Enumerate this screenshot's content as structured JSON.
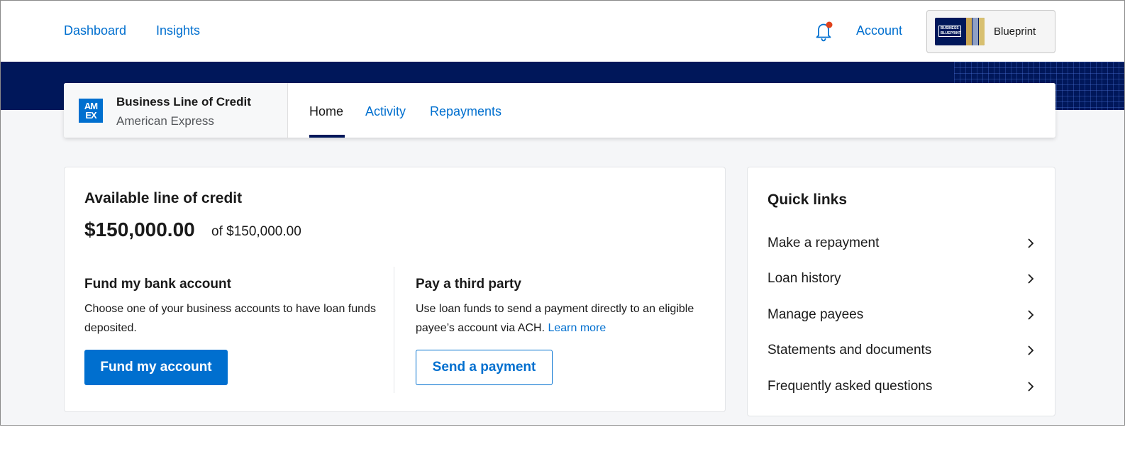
{
  "header": {
    "nav": [
      {
        "label": "Dashboard"
      },
      {
        "label": "Insights"
      }
    ],
    "account_label": "Account",
    "blueprint_label": "Blueprint",
    "blueprint_card_text": "BUSINESS BLUEPRINT",
    "notification_dot_color": "#e0421b"
  },
  "product": {
    "logo_text": "AM EX",
    "title": "Business Line of Credit",
    "subtitle": "American Express",
    "tabs": [
      {
        "label": "Home",
        "active": true
      },
      {
        "label": "Activity",
        "active": false
      },
      {
        "label": "Repayments",
        "active": false
      }
    ]
  },
  "credit": {
    "title": "Available line of credit",
    "amount": "$150,000.00",
    "of_total": "of $150,000.00"
  },
  "fund": {
    "title": "Fund my bank account",
    "description": "Choose one of your business accounts to have loan funds deposited.",
    "button": "Fund my account"
  },
  "third_party": {
    "title": "Pay a third party",
    "description": "Use loan funds to send a payment directly to an eligible payee’s account via ACH.",
    "learn_more": "Learn more",
    "button": "Send a payment"
  },
  "quick_links": {
    "title": "Quick links",
    "items": [
      {
        "label": "Make a repayment"
      },
      {
        "label": "Loan history"
      },
      {
        "label": "Manage payees"
      },
      {
        "label": "Statements and documents"
      },
      {
        "label": "Frequently asked questions"
      }
    ]
  },
  "colors": {
    "brand_blue": "#006fcf",
    "navy": "#00175a"
  }
}
